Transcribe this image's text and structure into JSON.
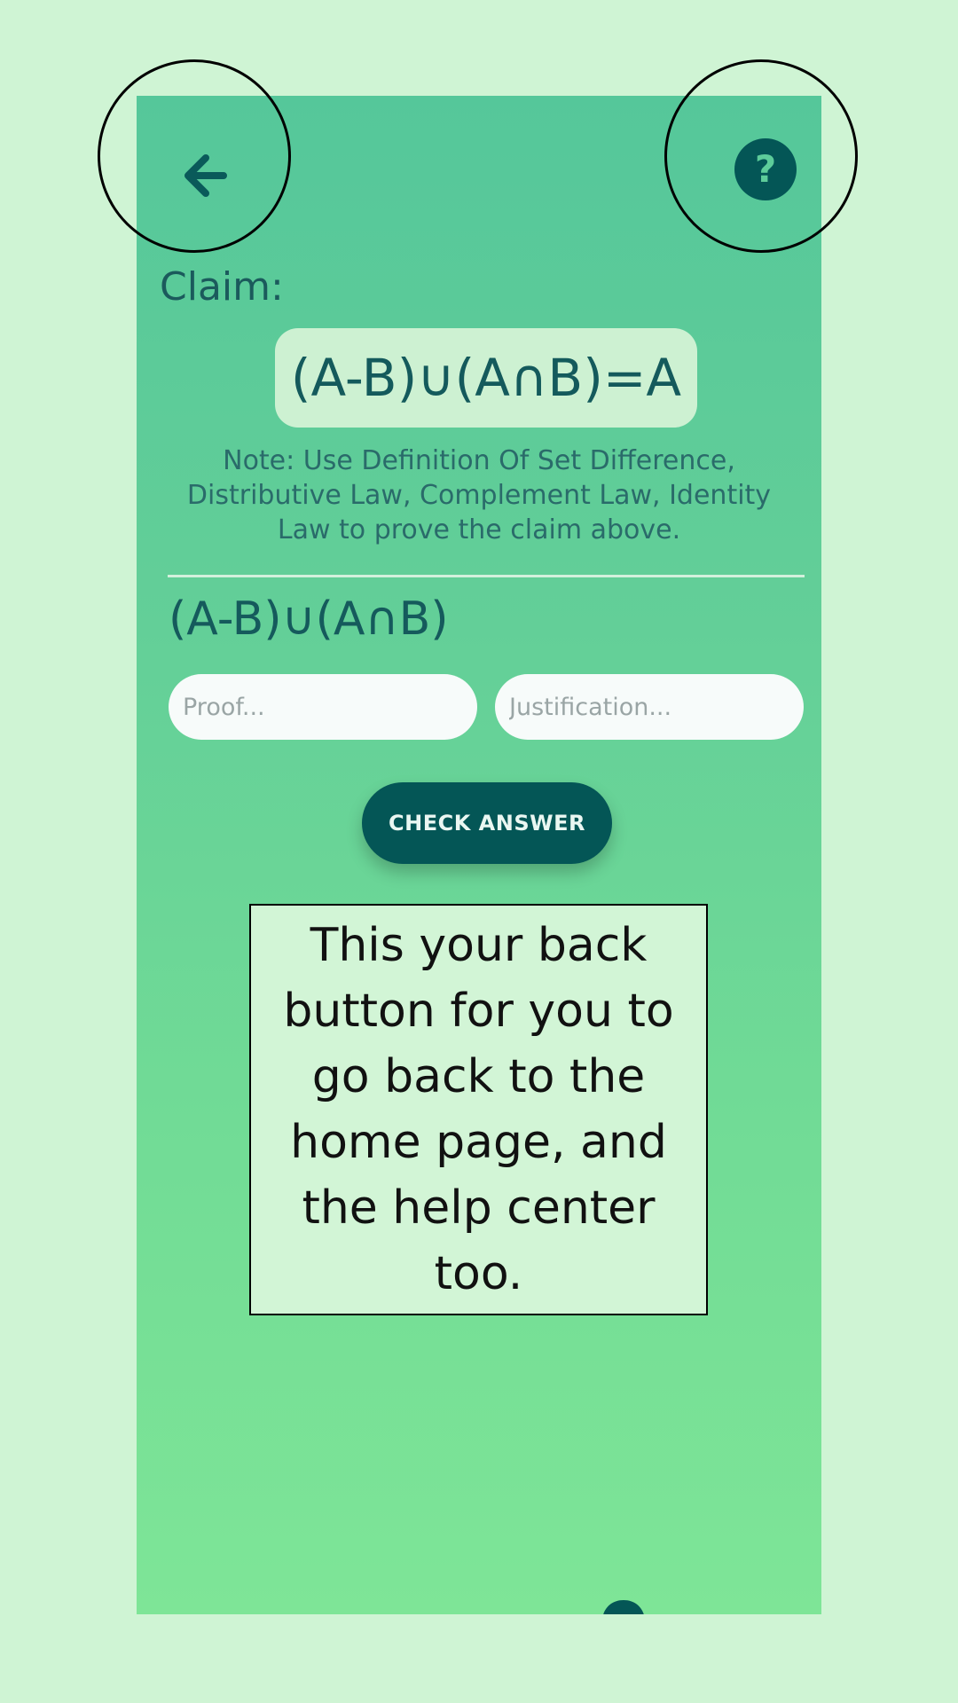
{
  "header": {
    "back_icon": "arrow-left-icon",
    "help_icon": "question-circle-icon",
    "help_glyph": "?"
  },
  "claim": {
    "label": "Claim:",
    "equation": "(A-B)∪(A∩B)=A",
    "note": "Note: Use Definition Of Set Difference, Distributive Law, Complement Law, Identity Law to prove the claim above."
  },
  "work": {
    "expression": "(A-B)∪(A∩B)",
    "proof_placeholder": "Proof...",
    "justification_placeholder": "Justification...",
    "check_label": "CHECK ANSWER"
  },
  "tutorial": {
    "callout_text": "This your back button for you to go back to the home page, and the help center too."
  },
  "footer": {
    "hint_icon": "lightbulb-icon"
  },
  "colors": {
    "background": "#cff4d4",
    "gradient_top": "#55c79a",
    "gradient_bottom": "#7ee597",
    "accent_dark": "#045656"
  }
}
